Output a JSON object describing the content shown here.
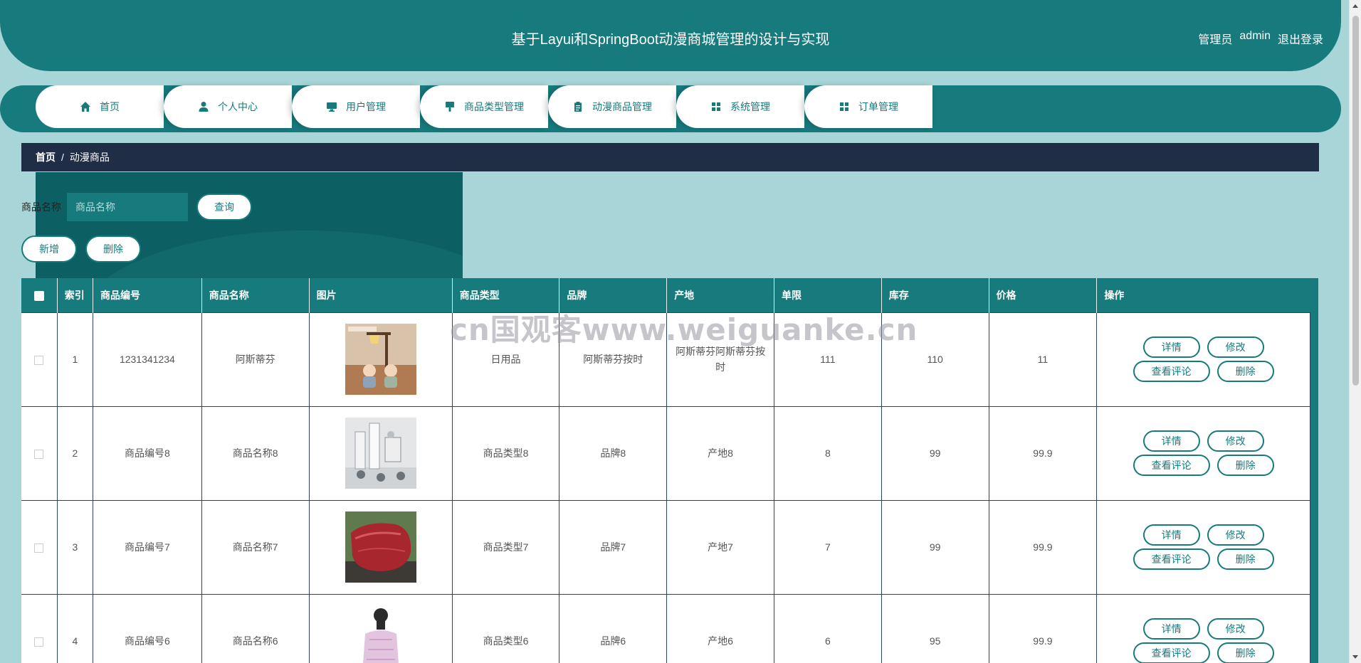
{
  "header": {
    "title": "基于Layui和SpringBoot动漫商城管理的设计与实现",
    "user_role": "管理员",
    "username": "admin",
    "logout": "退出登录"
  },
  "nav": {
    "items": [
      {
        "label": "首页",
        "icon": "home-icon"
      },
      {
        "label": "个人中心",
        "icon": "user-icon"
      },
      {
        "label": "用户管理",
        "icon": "monitor-icon"
      },
      {
        "label": "商品类型管理",
        "icon": "brush-icon"
      },
      {
        "label": "动漫商品管理",
        "icon": "clipboard-icon"
      },
      {
        "label": "系统管理",
        "icon": "grid-icon"
      },
      {
        "label": "订单管理",
        "icon": "grid-icon"
      }
    ]
  },
  "breadcrumb": {
    "home": "首页",
    "separator": "/",
    "current": "动漫商品"
  },
  "search": {
    "label": "商品名称",
    "placeholder": "商品名称",
    "query_button": "查询"
  },
  "actions": {
    "add": "新增",
    "delete": "删除"
  },
  "table": {
    "headers": [
      "索引",
      "商品编号",
      "商品名称",
      "图片",
      "商品类型",
      "品牌",
      "产地",
      "单限",
      "库存",
      "价格",
      "操作"
    ],
    "op_labels": {
      "detail": "详情",
      "edit": "修改",
      "comments": "查看评论",
      "delete": "删除"
    },
    "rows": [
      {
        "index": "1",
        "code": "1231341234",
        "name": "阿斯蒂芬",
        "image": "figurine-lamp-photo",
        "type": "日用品",
        "brand": "阿斯蒂芬按时",
        "origin": "阿斯蒂芬阿斯蒂芬按时",
        "limit": "111",
        "stock": "110",
        "price": "11"
      },
      {
        "index": "2",
        "code": "商品编号8",
        "name": "商品名称8",
        "image": "figurine-set-photo",
        "type": "商品类型8",
        "brand": "品牌8",
        "origin": "产地8",
        "limit": "8",
        "stock": "99",
        "price": "99.9"
      },
      {
        "index": "3",
        "code": "商品编号7",
        "name": "商品名称7",
        "image": "raw-beef-photo",
        "type": "商品类型7",
        "brand": "品牌7",
        "origin": "产地7",
        "limit": "7",
        "stock": "99",
        "price": "99.9"
      },
      {
        "index": "4",
        "code": "商品编号6",
        "name": "商品名称6",
        "image": "pink-jacket-photo",
        "type": "商品类型6",
        "brand": "品牌6",
        "origin": "产地6",
        "limit": "6",
        "stock": "95",
        "price": "99.9"
      }
    ]
  },
  "watermark": "cn国观客www.weiguanke.cn",
  "colors": {
    "primary": "#177a7c",
    "background": "#a8d6d8",
    "breadcrumb_bg": "#1f2d45"
  }
}
